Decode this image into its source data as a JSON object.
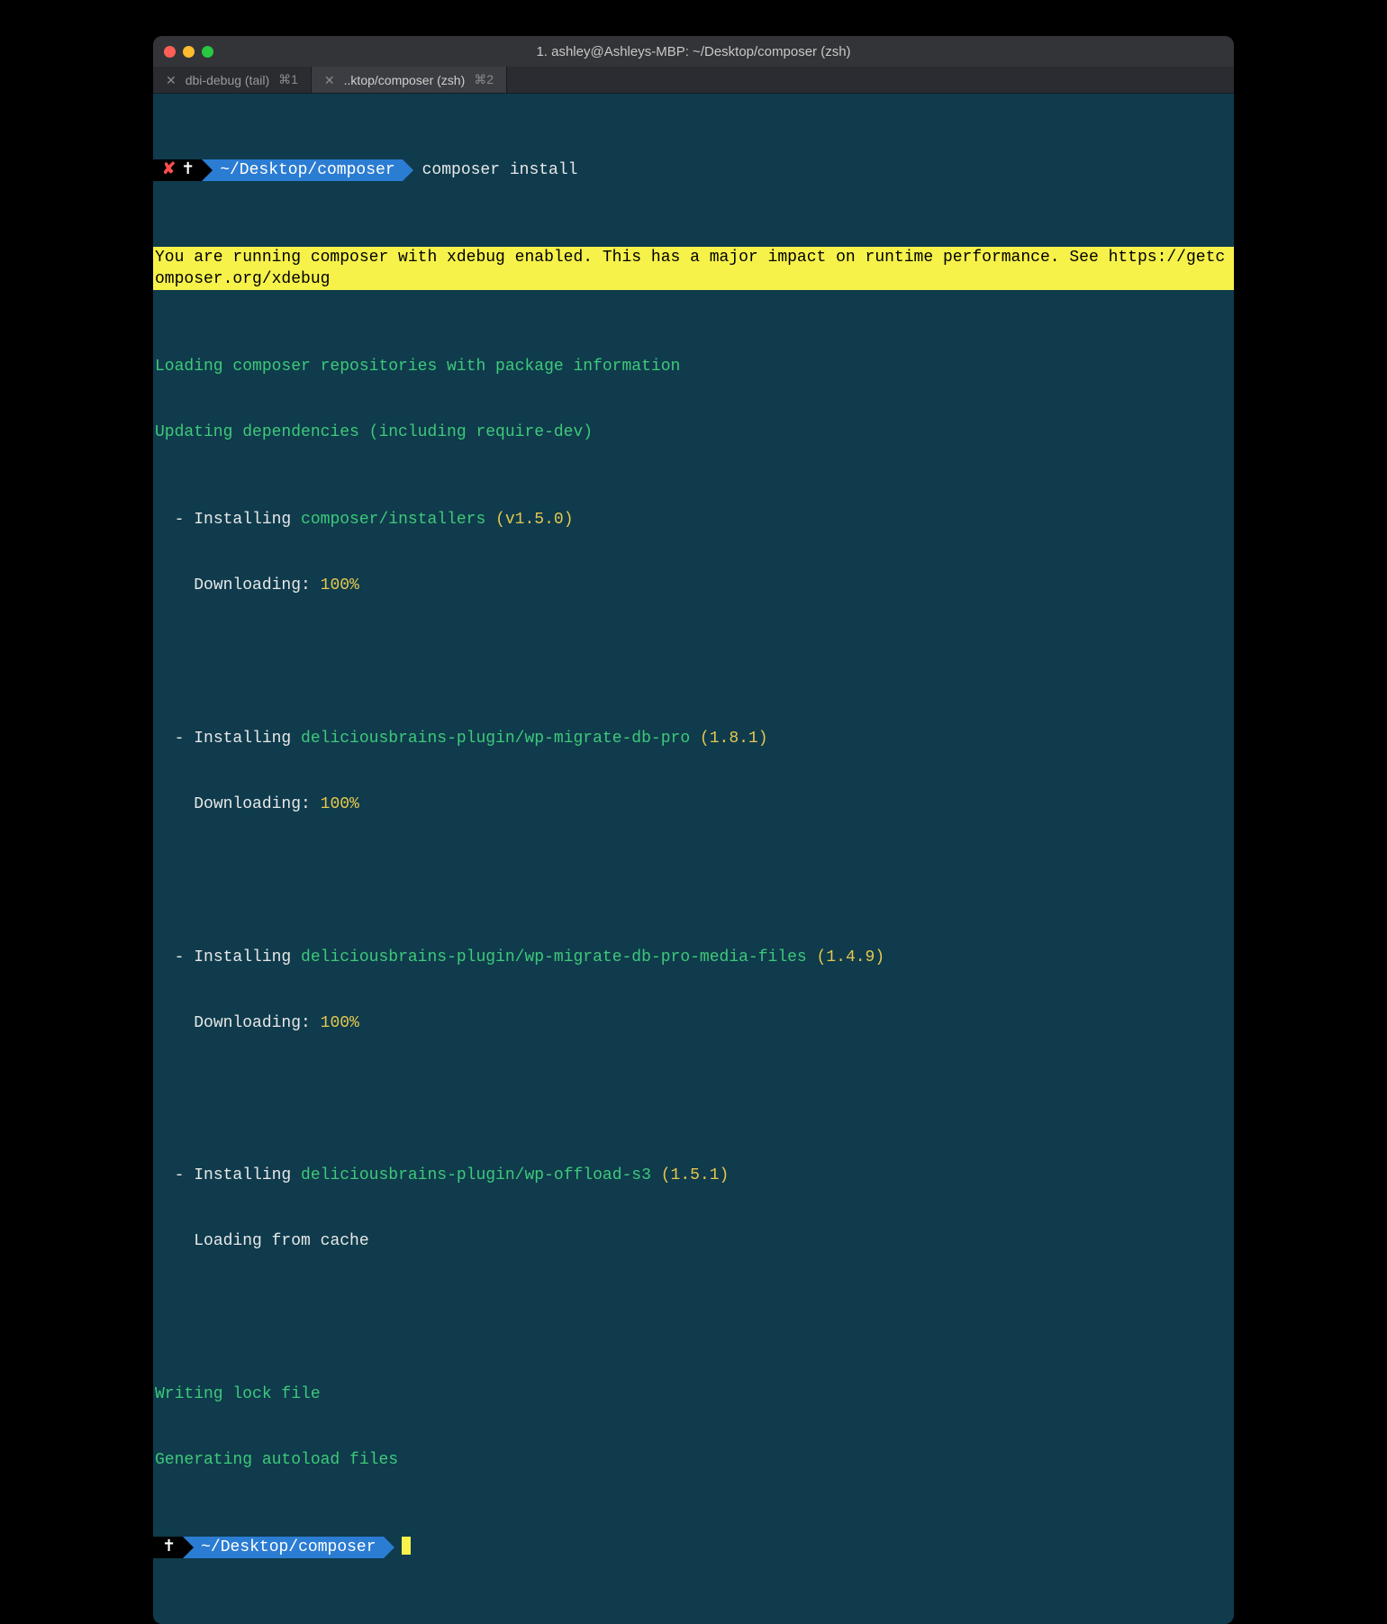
{
  "window": {
    "title": "1. ashley@Ashleys-MBP: ~/Desktop/composer (zsh)"
  },
  "tabs": [
    {
      "label": "dbi-debug (tail)",
      "shortcut": "⌘1",
      "active": false
    },
    {
      "label": "..ktop/composer (zsh)",
      "shortcut": "⌘2",
      "active": true
    }
  ],
  "prompt1": {
    "status_x": "✘",
    "dagger": "✝",
    "path": "~/Desktop/composer",
    "command": "composer install"
  },
  "warning": "You are running composer with xdebug enabled. This has a major impact on runtime performance. See https://getcomposer.org/xdebug",
  "lines": {
    "loading": "Loading composer repositories with package information",
    "updating": "Updating dependencies (including require-dev)",
    "writing": "Writing lock file",
    "generating": "Generating autoload files"
  },
  "installs": [
    {
      "prefix": "  - Installing ",
      "pkg": "composer/installers",
      "ver": " (v1.5.0)",
      "dl_label": "    Downloading: ",
      "dl_pct": "100%"
    },
    {
      "prefix": "  - Installing ",
      "pkg": "deliciousbrains-plugin/wp-migrate-db-pro",
      "ver": " (1.8.1)",
      "dl_label": "    Downloading: ",
      "dl_pct": "100%"
    },
    {
      "prefix": "  - Installing ",
      "pkg": "deliciousbrains-plugin/wp-migrate-db-pro-media-files",
      "ver": " (1.4.9)",
      "dl_label": "    Downloading: ",
      "dl_pct": "100%"
    },
    {
      "prefix": "  - Installing ",
      "pkg": "deliciousbrains-plugin/wp-offload-s3",
      "ver": " (1.5.1)",
      "dl_label": "    Loading from cache",
      "dl_pct": ""
    }
  ],
  "prompt2": {
    "dagger": "✝",
    "path": "~/Desktop/composer"
  }
}
